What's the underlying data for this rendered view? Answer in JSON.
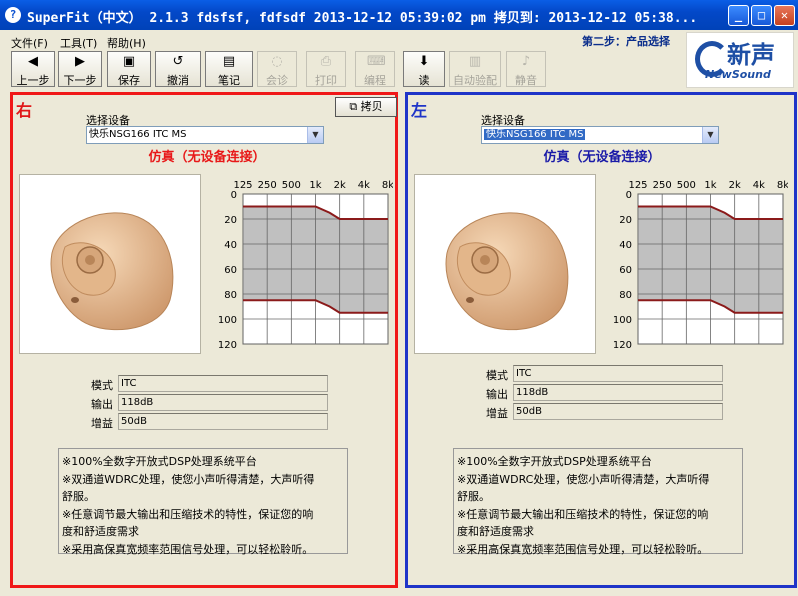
{
  "window": {
    "title": "SuperFit（中文） 2.1.3 fdsfsf, fdfsdf 2013-12-12 05:39:02 pm 拷贝到: 2013-12-12 05:38...",
    "min_label": "_",
    "max_label": "□",
    "close_label": "✕"
  },
  "menu": {
    "items": [
      "文件(F)",
      "工具(T)",
      "帮助(H)"
    ]
  },
  "toolbar": {
    "buttons": [
      {
        "label": "上一步",
        "icon": "back-arrow-icon",
        "glyph": "◀",
        "enabled": true
      },
      {
        "label": "下一步",
        "icon": "forward-arrow-icon",
        "glyph": "▶",
        "enabled": true
      },
      {
        "label": "保存",
        "icon": "floppy-disk-icon",
        "glyph": "▣",
        "enabled": true
      },
      {
        "label": "撤消",
        "icon": "undo-icon",
        "glyph": "↺",
        "enabled": true
      },
      {
        "label": "笔记",
        "icon": "notebook-icon",
        "glyph": "▤",
        "enabled": true
      },
      {
        "label": "会诊",
        "icon": "stethoscope-icon",
        "glyph": "◌",
        "enabled": false
      },
      {
        "label": "打印",
        "icon": "printer-icon",
        "glyph": "⎙",
        "enabled": false
      },
      {
        "label": "编程",
        "icon": "program-icon",
        "glyph": "⌨",
        "enabled": false
      },
      {
        "label": "读",
        "icon": "read-icon",
        "glyph": "⬇",
        "enabled": true
      },
      {
        "label": "自动验配",
        "icon": "auto-fit-icon",
        "glyph": "▥",
        "enabled": false
      },
      {
        "label": "静音",
        "icon": "speaker-mute-icon",
        "glyph": "♪",
        "enabled": false
      }
    ]
  },
  "step_label": "第二步：产品选择",
  "logo": {
    "cn": "新声",
    "en": "NewSound"
  },
  "panels": {
    "right": {
      "side": "右",
      "copy_label": "拷贝",
      "device_label": "选择设备",
      "device_value": "快乐NSG166 ITC MS",
      "sim_text": "仿真（无设备连接）",
      "model_label": "模式",
      "model_value": "ITC",
      "output_label": "输出",
      "output_value": "118dB",
      "gain_label": "增益",
      "gain_value": "50dB",
      "desc_lines": [
        "※100%全数字开放式DSP处理系统平台",
        "※双通道WDRC处理，使您小声听得清楚，大声听得",
        "舒服。",
        "※任意调节最大输出和压缩技术的特性，保证您的响",
        "度和舒适度需求",
        "※采用高保真宽频率范围信号处理，可以轻松聆听。"
      ]
    },
    "left": {
      "side": "左",
      "device_label": "选择设备",
      "device_value": "快乐NSG166 ITC MS",
      "sim_text": "仿真（无设备连接）",
      "model_label": "模式",
      "model_value": "ITC",
      "output_label": "输出",
      "output_value": "118dB",
      "gain_label": "增益",
      "gain_value": "50dB",
      "desc_lines": [
        "※100%全数字开放式DSP处理系统平台",
        "※双通道WDRC处理，使您小声听得清楚，大声听得",
        "舒服。",
        "※任意调节最大输出和压缩技术的特性，保证您的响",
        "度和舒适度需求",
        "※采用高保真宽频率范围信号处理，可以轻松聆听。"
      ]
    }
  },
  "chart_data": {
    "type": "area",
    "x_ticks": [
      "125",
      "250",
      "500",
      "1k",
      "2k",
      "4k",
      "8k"
    ],
    "y_ticks": [
      "0",
      "20",
      "40",
      "60",
      "80",
      "100",
      "120"
    ],
    "ylim": [
      0,
      120
    ],
    "y_inverted": true,
    "grid": true,
    "x_values_hz": [
      125,
      250,
      500,
      750,
      1000,
      1500,
      2000,
      4000,
      8000
    ],
    "upper_db": [
      10,
      10,
      10,
      10,
      10,
      15,
      20,
      20,
      20
    ],
    "lower_db": [
      85,
      85,
      85,
      85,
      85,
      90,
      95,
      95,
      95
    ],
    "fill_color": "#c0c0c0",
    "line_color": "#8b1a1a"
  }
}
